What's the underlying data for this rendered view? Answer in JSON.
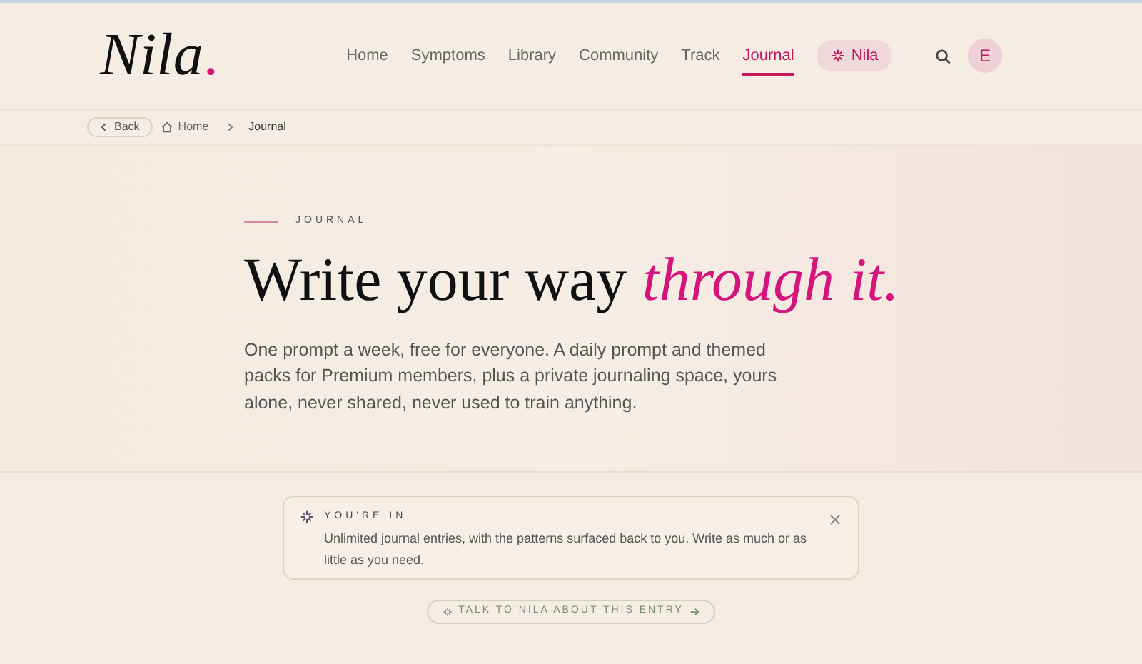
{
  "header": {
    "logo": "Nila",
    "logo_dot": ".",
    "nav": [
      {
        "label": "Home",
        "selected": false,
        "kind": "link"
      },
      {
        "label": "Symptoms",
        "selected": false,
        "kind": "link"
      },
      {
        "label": "Library",
        "selected": false,
        "kind": "link"
      },
      {
        "label": "Community",
        "selected": false,
        "kind": "link"
      },
      {
        "label": "Track",
        "selected": false,
        "kind": "link"
      },
      {
        "label": "Journal",
        "selected": true,
        "kind": "link"
      },
      {
        "label": "Nila",
        "selected": false,
        "kind": "pill"
      }
    ],
    "avatar": "E"
  },
  "breadcrumb": {
    "back": "Back",
    "items": [
      "Home",
      "Journal"
    ]
  },
  "hero": {
    "eyebrow": "JOURNAL",
    "title": "Write your way",
    "title_accent": "through it.",
    "body": "One prompt a week, free for everyone. A daily prompt and themed packs for Premium members, plus a private journaling space, yours alone, never shared, never used to train anything."
  },
  "notice": {
    "title": "YOU'RE IN",
    "text": "Unlimited journal entries, with the patterns surfaced back to you. Write as much or as little as you need."
  },
  "action": {
    "label": "TALK TO NILA ABOUT THIS ENTRY"
  }
}
